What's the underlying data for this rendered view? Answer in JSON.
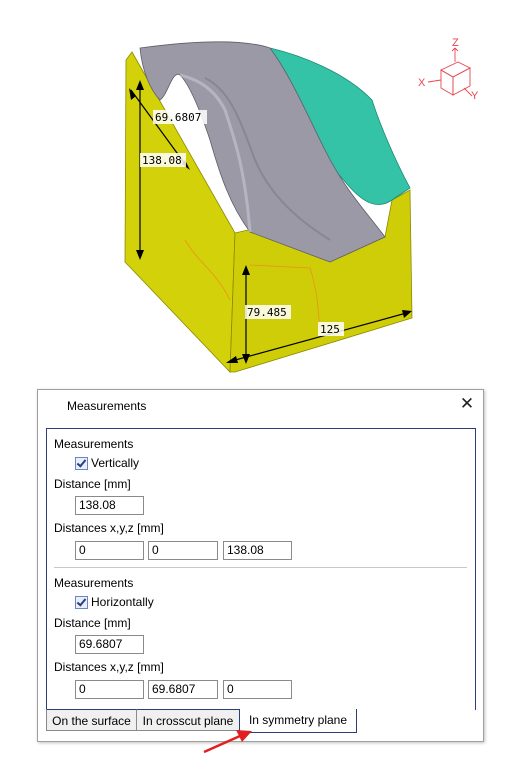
{
  "viewport": {
    "dimensions": {
      "width_overall": "69.6807",
      "height_overall": "138.08",
      "height_front": "79.485",
      "length_front": "125"
    },
    "axis": {
      "z": "Z",
      "x": "X",
      "y": "Y"
    },
    "colors": {
      "yellow": "#d3d10a",
      "teal": "#35c3a7",
      "gray": "#9b99a6"
    }
  },
  "dialog": {
    "title": "Measurements",
    "close_label": "✕",
    "vertical": {
      "group_label": "Measurements",
      "checkbox_label": "Vertically",
      "checked": true,
      "distance_label": "Distance [mm]",
      "distance_value": "138.08",
      "xyz_label": "Distances x,y,z [mm]",
      "x": "0",
      "y": "0",
      "z": "138.08"
    },
    "horizontal": {
      "group_label": "Measurements",
      "checkbox_label": "Horizontally",
      "checked": true,
      "distance_label": "Distance [mm]",
      "distance_value": "69.6807",
      "xyz_label": "Distances x,y,z [mm]",
      "x": "0",
      "y": "69.6807",
      "z": "0"
    },
    "tabs": [
      "On the surface",
      "In crosscut plane",
      "In symmetry plane"
    ],
    "active_tab": "In symmetry plane"
  },
  "annotation_arrow_color": "#e02020"
}
